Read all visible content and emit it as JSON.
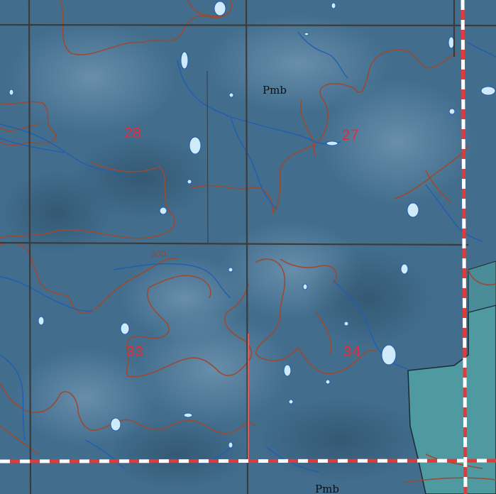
{
  "map": {
    "sections": [
      "28",
      "27",
      "33",
      "34"
    ],
    "contour_label": "300",
    "geology_labels": [
      "Pmb",
      "Pmb"
    ]
  },
  "colors": {
    "terrain": "#426d8d",
    "terrain_light": "#6f95b2",
    "grid_line": "#3b3b3b",
    "contour": "#9a4a30",
    "stream": "#1f5fb0",
    "lake": "#cfeaf8",
    "section_number": "#e8283a",
    "boundary_red": "#e03a3a",
    "boundary_white": "#ffffff",
    "water_polygon": "#4f9aa0"
  }
}
